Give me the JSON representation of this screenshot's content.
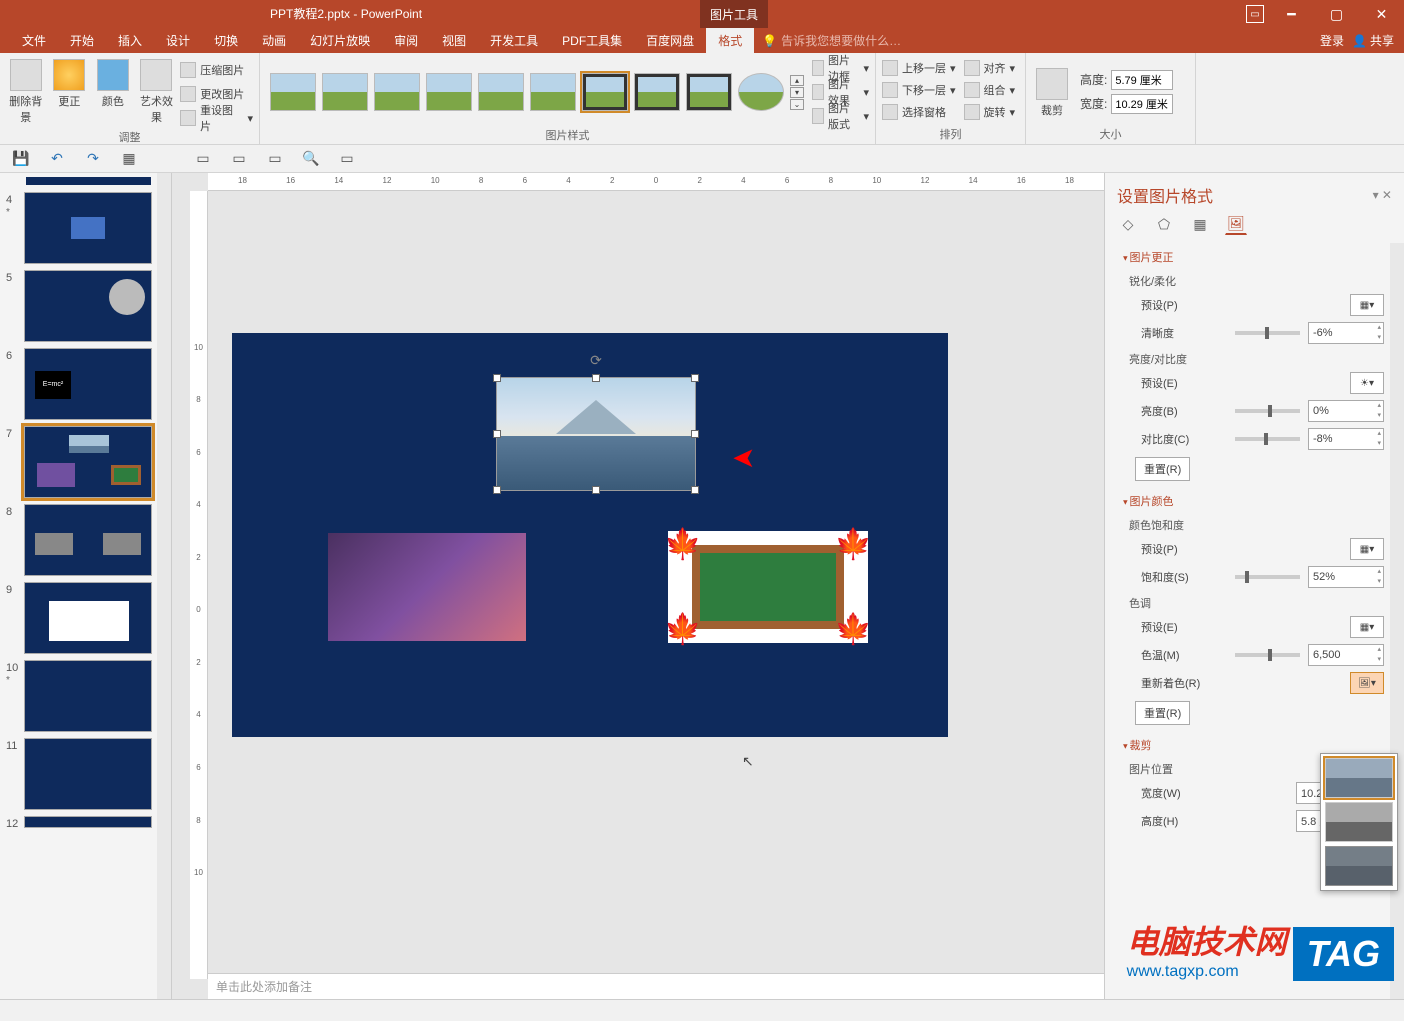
{
  "title": {
    "doc": "PPT教程2.pptx - PowerPoint",
    "context": "图片工具"
  },
  "tabs": {
    "file": "文件",
    "home": "开始",
    "insert": "插入",
    "design": "设计",
    "trans": "切换",
    "anim": "动画",
    "show": "幻灯片放映",
    "review": "审阅",
    "view": "视图",
    "dev": "开发工具",
    "pdf": "PDF工具集",
    "baidu": "百度网盘",
    "format": "格式",
    "tell": "告诉我您想要做什么…",
    "login": "登录",
    "share": "共享"
  },
  "ribbon": {
    "adjust": {
      "label": "调整",
      "removebg": "删除背景",
      "correct": "更正",
      "color": "颜色",
      "artistic": "艺术效果",
      "compress": "压缩图片",
      "change": "更改图片",
      "reset": "重设图片"
    },
    "styles": {
      "label": "图片样式",
      "border": "图片边框",
      "effects": "图片效果",
      "layout": "图片版式"
    },
    "arrange": {
      "label": "排列",
      "forward": "上移一层",
      "backward": "下移一层",
      "selpane": "选择窗格",
      "align": "对齐",
      "group": "组合",
      "rotate": "旋转"
    },
    "size": {
      "label": "大小",
      "crop": "裁剪",
      "height_lbl": "高度:",
      "width_lbl": "宽度:",
      "height": "5.79 厘米",
      "width": "10.29 厘米"
    }
  },
  "thumbs": [
    {
      "n": "4",
      "star": "*"
    },
    {
      "n": "5"
    },
    {
      "n": "6"
    },
    {
      "n": "7",
      "sel": true
    },
    {
      "n": "8"
    },
    {
      "n": "9"
    },
    {
      "n": "10",
      "star": "*"
    },
    {
      "n": "11"
    },
    {
      "n": "12"
    }
  ],
  "ruler_h": [
    "18",
    "16",
    "14",
    "12",
    "10",
    "8",
    "6",
    "4",
    "2",
    "0",
    "2",
    "4",
    "6",
    "8",
    "10",
    "12",
    "14",
    "16",
    "18"
  ],
  "ruler_v": [
    "10",
    "8",
    "6",
    "4",
    "2",
    "0",
    "2",
    "4",
    "6",
    "8",
    "10"
  ],
  "notes": "单击此处添加备注",
  "pane": {
    "title": "设置图片格式",
    "s_correct": "图片更正",
    "sharp_soft": "锐化/柔化",
    "preset_p": "预设(P)",
    "clarity": "清晰度",
    "clarity_v": "-6%",
    "bright_contrast": "亮度/对比度",
    "preset_e": "预设(E)",
    "brightness": "亮度(B)",
    "brightness_v": "0%",
    "contrast": "对比度(C)",
    "contrast_v": "-8%",
    "reset": "重置(R)",
    "s_color": "图片颜色",
    "saturation_h": "颜色饱和度",
    "preset_p2": "预设(P)",
    "saturation": "饱和度(S)",
    "saturation_v": "52%",
    "tone": "色调",
    "preset_e2": "预设(E)",
    "temp": "色温(M)",
    "temp_v": "6,500",
    "recolor": "重新着色(R)",
    "reset2": "重置(R)",
    "s_crop": "裁剪",
    "pic_pos": "图片位置",
    "width_w": "宽度(W)",
    "width_v": "10.29 厘米",
    "height_h": "高度(H)",
    "height_v": "5.8 厘米"
  },
  "watermark": {
    "txt1": "电脑技术网",
    "txt2": "www.tagxp.com",
    "tag": "TAG"
  }
}
